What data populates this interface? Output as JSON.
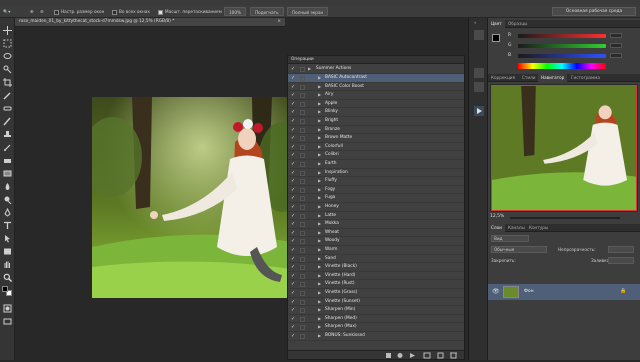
{
  "options_bar": {
    "fit_window_label": "Настр. размер окон",
    "all_windows_label": "Во всех окнах",
    "scrubby_zoom_label": "Масшт. перетаскиванием",
    "zoom_100_label": "100%",
    "fit_screen_label": "Подогнать",
    "fill_screen_label": "Полный экран",
    "workspace_label": "Основная рабочая среда"
  },
  "document": {
    "tab_title": "rose_maiden_01_by_kittythecat_stock-d7mmdsw.jpg @ 12,5% (RGB/8) *",
    "close_glyph": "×"
  },
  "actions_panel": {
    "title": "Операции",
    "set_name": "Summer Actions",
    "check_glyph": "✓",
    "expand_glyph": "▶",
    "items": [
      "BASIC Autocontrast",
      "BASIC Color Boost",
      "Airy",
      "Apple",
      "Blinky",
      "Bright",
      "Bronze",
      "Brown Matte",
      "Colorfull",
      "Colibri",
      "Earth",
      "Inspiration",
      "Fluffy",
      "Fogy",
      "Fuga",
      "Honey",
      "Latte",
      "Mokka",
      "Wheat",
      "Woody",
      "Warm",
      "Sand",
      "Vinette (Black)",
      "Vinette (Hard)",
      "Vinette (Rust)",
      "Vinette (Grass)",
      "Vinette (Sunset)",
      "Sharpen (Min)",
      "Sharpen (Med)",
      "Sharpen (Max)",
      "BONUS: Sunkissed"
    ],
    "selected_index": 0
  },
  "color_panel": {
    "tabs": [
      "Цвет",
      "Образцы"
    ],
    "channels": [
      {
        "label": "R",
        "color": "#ff3030"
      },
      {
        "label": "G",
        "color": "#30d030"
      },
      {
        "label": "B",
        "color": "#3050ff"
      }
    ]
  },
  "navigator_panel": {
    "tabs": [
      "Коррекция",
      "Стили",
      "Навигатор",
      "Гистограмма"
    ],
    "zoom": "12,5%"
  },
  "layers_panel": {
    "tabs": [
      "Слои",
      "Каналы",
      "Контуры"
    ],
    "kind_label": "Вид",
    "blend_mode": "Обычные",
    "opacity_label": "Непрозрачность:",
    "lock_label": "Закрепить:",
    "fill_label": "Заливка:",
    "layer_name": "Фон"
  },
  "colors": {
    "accent_selected": "#4f5f78",
    "panel_bg": "#3d3d3d",
    "nav_frame": "#d23a3a"
  }
}
